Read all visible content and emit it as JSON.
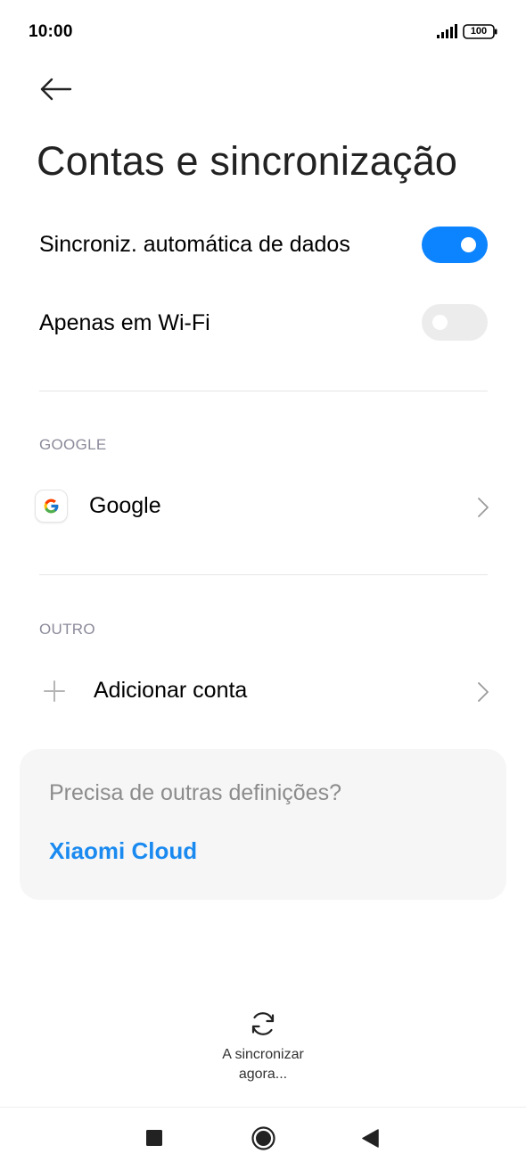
{
  "status_bar": {
    "time": "10:00",
    "battery": "100",
    "icons": [
      "signal-icon",
      "battery-icon"
    ]
  },
  "header": {
    "back_icon": "arrow-left-icon",
    "title": "Contas e sincronização"
  },
  "settings": {
    "auto_sync": {
      "label": "Sincroniz. automática de dados",
      "enabled": true
    },
    "wifi_only": {
      "label": "Apenas em Wi-Fi",
      "enabled": false
    }
  },
  "sections": {
    "google": {
      "header": "GOOGLE",
      "account_label": "Google",
      "account_icon": "google-g-icon"
    },
    "other": {
      "header": "OUTRO",
      "add_account_label": "Adicionar conta",
      "add_icon": "plus-icon"
    }
  },
  "card": {
    "hint": "Precisa de outras definições?",
    "link": "Xiaomi Cloud"
  },
  "sync": {
    "icon": "sync-icon",
    "line1": "A sincronizar",
    "line2": "agora..."
  },
  "nav_bar": {
    "icons": [
      "square-recents-icon",
      "circle-home-icon",
      "triangle-back-icon"
    ]
  },
  "colors": {
    "accent": "#0d84ff",
    "link": "#1a8af0",
    "toggle_off": "#ececec",
    "card_bg": "#f6f6f6",
    "section_header": "#8a8a9a"
  }
}
